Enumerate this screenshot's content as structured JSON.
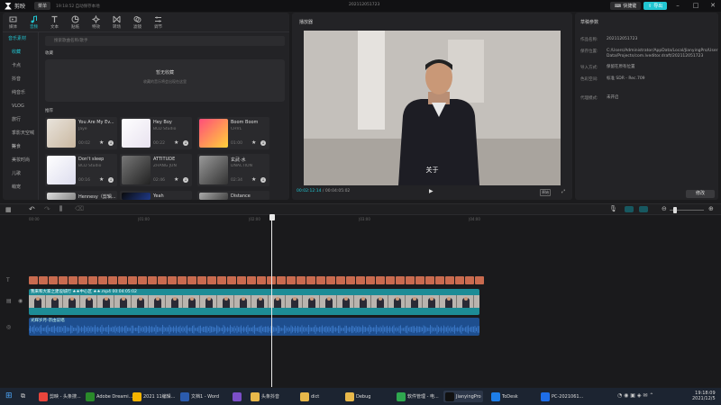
{
  "titlebar": {
    "app_name": "剪映",
    "menu": "菜单",
    "autosave": "19:18:52 自动保存本地",
    "doc_title": "202112051723",
    "shortcut": "快捷键",
    "export": "导出"
  },
  "toolbar": [
    {
      "label": "媒体",
      "icon": "media-icon"
    },
    {
      "label": "音频",
      "icon": "audio-icon",
      "active": true
    },
    {
      "label": "文本",
      "icon": "text-icon"
    },
    {
      "label": "贴纸",
      "icon": "sticker-icon"
    },
    {
      "label": "特效",
      "icon": "effects-icon"
    },
    {
      "label": "转场",
      "icon": "transition-icon"
    },
    {
      "label": "滤镜",
      "icon": "filter-icon"
    },
    {
      "label": "调节",
      "icon": "adjust-icon"
    }
  ],
  "categories": {
    "header": "音乐素材",
    "items": [
      "收藏",
      "卡点",
      "抖音",
      "纯音乐",
      "VLOG",
      "旅行",
      "季影天空喊好",
      "美食",
      "美妆时尚",
      "儿歌",
      "萌宠"
    ]
  },
  "search_placeholder": "搜索歌曲名称/歌手",
  "favorites": {
    "label": "收藏",
    "empty": "暂无收藏",
    "hint": "收藏的音乐将会出现在这里"
  },
  "recommended_label": "推荐",
  "music": [
    {
      "title": "You Are My Ev...",
      "artist": "Jaye",
      "duration": "00:02"
    },
    {
      "title": "Hey Boy",
      "artist": "BCD Studio",
      "duration": "00:22"
    },
    {
      "title": "Boom Boom",
      "artist": "CHVL",
      "duration": "01:00"
    },
    {
      "title": "Don't sleep",
      "artist": "BCD Studio",
      "duration": "00:16"
    },
    {
      "title": "ATTITUDE",
      "artist": "ZHANG JUN",
      "duration": "02:46"
    },
    {
      "title": "玄武·水",
      "artist": "DNACTION",
      "duration": "02:34"
    },
    {
      "title": "Hennesy（剪辑...",
      "artist": "X-GANG/Psycho",
      "duration": ""
    },
    {
      "title": "Yeah",
      "artist": "Ibo",
      "duration": ""
    },
    {
      "title": "Distance",
      "artist": "DK屋",
      "duration": ""
    }
  ],
  "player": {
    "title": "播放器",
    "subtitle": "关于",
    "current": "00:02:12:14",
    "total": "00:04:05:02",
    "ratio": "原始"
  },
  "draft": {
    "title": "草稿参数",
    "rows": [
      {
        "key": "作品名称:",
        "value": "202112051723"
      },
      {
        "key": "保存位置:",
        "value": "C:/Users/Administrator/AppData/Local/JianyingPro/User Data/Projects/com.lveditor.draft/202112051723"
      },
      {
        "key": "导入方式:",
        "value": "保留在原有位置"
      },
      {
        "key": "色彩空间:",
        "value": "标准 SDR - Rec.709"
      },
      {
        "key": "代理模式:",
        "value": "未开启"
      }
    ],
    "edit": "修改"
  },
  "timeline": {
    "ticks": [
      "00:00",
      "|01:00",
      "|02:00",
      "|03:00",
      "|04:00"
    ],
    "video_label": "我来和大家之建设城行 ★★中心区 ★★.mp4  00:04:05:02",
    "audio_label": "光辉岁月-宗由说唱"
  },
  "taskbar": [
    {
      "label": "剪映 - 头条搜...",
      "color": "#e8453c"
    },
    {
      "label": "Adobe Dreami...",
      "color": "#2a8a2a"
    },
    {
      "label": "2021 11编辑...",
      "color": "#f5b400"
    },
    {
      "label": "文档1 - Word",
      "color": "#2b5bad"
    },
    {
      "label": "",
      "color": "#7b4fc7"
    },
    {
      "label": "头条抖音",
      "color": "#e8b84a"
    },
    {
      "label": "dict",
      "color": "#e8b84a"
    },
    {
      "label": "Debug",
      "color": "#e8b84a"
    },
    {
      "label": "软件管理 - 电...",
      "color": "#2fa84f"
    },
    {
      "label": "JianyingPro",
      "color": "#111",
      "open": true
    },
    {
      "label": "ToDesk",
      "color": "#1e7ee8"
    },
    {
      "label": "PC-2021061...",
      "color": "#1e6ee8"
    }
  ],
  "clock": {
    "time": "19:18:09",
    "date": "2021/12/5"
  }
}
